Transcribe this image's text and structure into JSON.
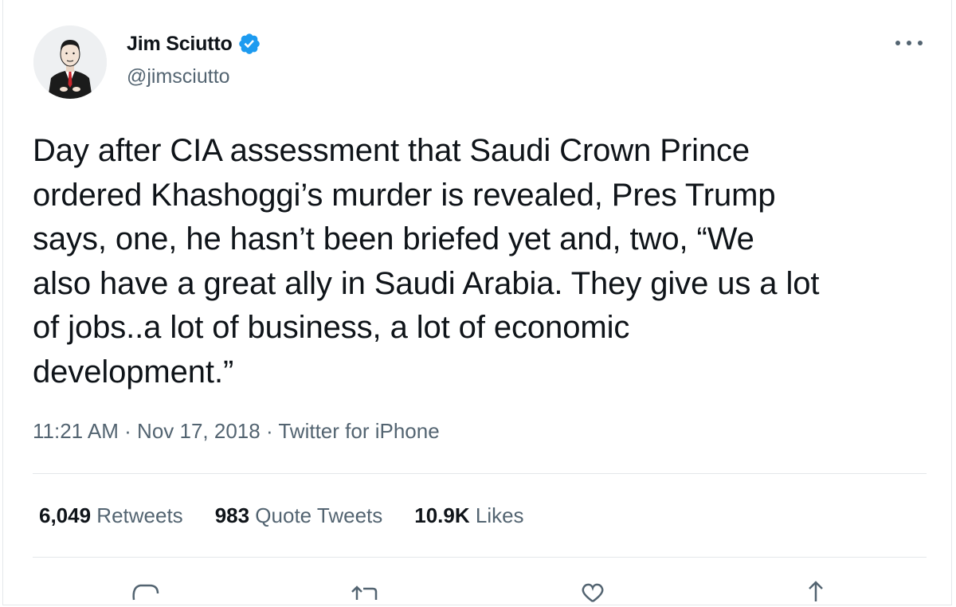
{
  "author": {
    "display_name": "Jim Sciutto",
    "handle": "@jimsciutto",
    "verified": true
  },
  "tweet": {
    "text": "Day after CIA assessment that Saudi Crown Prince\nordered Khashoggi’s murder is revealed, Pres Trump\nsays, one, he hasn’t been briefed yet and, two, “We\nalso have a great ally in Saudi Arabia. They give us a lot\nof jobs..a lot of business, a lot of economic\ndevelopment.”",
    "time": "11:21 AM",
    "date": "Nov 17, 2018",
    "source": "Twitter for iPhone",
    "separator": " · "
  },
  "stats": {
    "retweets": {
      "count": "6,049",
      "label": " Retweets"
    },
    "quotes": {
      "count": "983",
      "label": " Quote Tweets"
    },
    "likes": {
      "count": "10.9K",
      "label": " Likes"
    }
  },
  "icons": {
    "verified": "verified-badge-icon",
    "more": "more-options-icon",
    "reply": "reply-icon",
    "retweet": "retweet-icon",
    "like": "like-icon",
    "share": "share-icon"
  },
  "colors": {
    "verified": "#1d9bf0",
    "text": "#0f1419",
    "secondary": "#536471",
    "border": "#e4e7ea"
  }
}
